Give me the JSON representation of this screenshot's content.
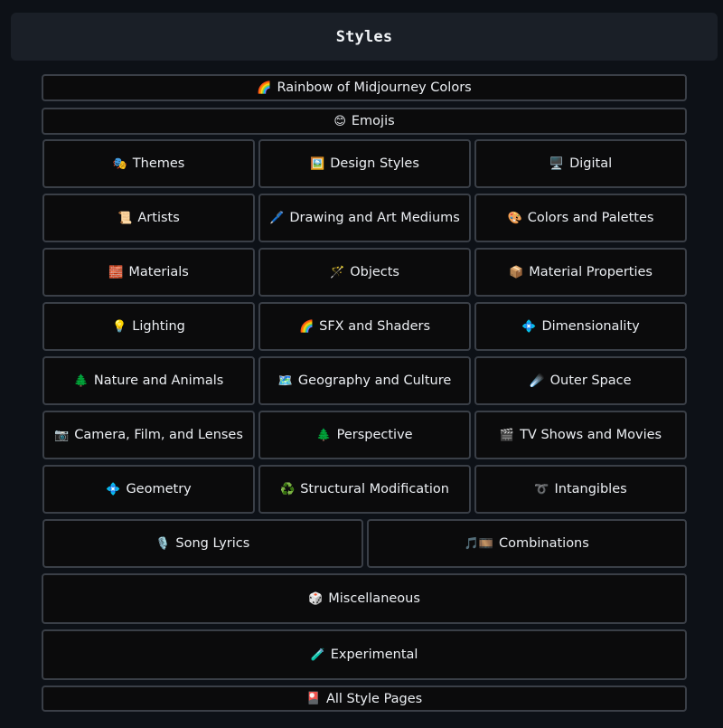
{
  "header": {
    "title": "Styles"
  },
  "rows": {
    "r0": [
      {
        "icon": "🌈",
        "label": "Rainbow of Midjourney Colors"
      }
    ],
    "r1": [
      {
        "icon": "😊",
        "label": "Emojis"
      }
    ],
    "r2": [
      {
        "icon": "🎭",
        "label": "Themes"
      },
      {
        "icon": "🖼️",
        "label": "Design Styles"
      },
      {
        "icon": "🖥️",
        "label": "Digital"
      }
    ],
    "r3": [
      {
        "icon": "📜",
        "label": "Artists"
      },
      {
        "icon": "🖊️",
        "label": "Drawing and Art Mediums"
      },
      {
        "icon": "🎨",
        "label": "Colors and Palettes"
      }
    ],
    "r4": [
      {
        "icon": "🧱",
        "label": "Materials"
      },
      {
        "icon": "🪄",
        "label": "Objects"
      },
      {
        "icon": "📦",
        "label": "Material Properties"
      }
    ],
    "r5": [
      {
        "icon": "💡",
        "label": "Lighting"
      },
      {
        "icon": "🌈",
        "label": "SFX and Shaders"
      },
      {
        "icon": "💠",
        "label": "Dimensionality"
      }
    ],
    "r6": [
      {
        "icon": "🌲",
        "label": "Nature and Animals"
      },
      {
        "icon": "🗺️",
        "label": "Geography and Culture"
      },
      {
        "icon": "☄️",
        "label": "Outer Space"
      }
    ],
    "r7": [
      {
        "icon": "📷",
        "label": "Camera, Film, and Lenses"
      },
      {
        "icon": "🌲",
        "label": "Perspective"
      },
      {
        "icon": "🎬",
        "label": "TV Shows and Movies"
      }
    ],
    "r8": [
      {
        "icon": "💠",
        "label": "Geometry"
      },
      {
        "icon": "♻️",
        "label": "Structural Modification"
      },
      {
        "icon": "➰",
        "label": "Intangibles"
      }
    ],
    "r9": [
      {
        "icon": "🎙️",
        "label": "Song Lyrics"
      },
      {
        "icon": "🎵🎞️",
        "label": "Combinations"
      }
    ],
    "r10": [
      {
        "icon": "🎲",
        "label": "Miscellaneous"
      }
    ],
    "r11": [
      {
        "icon": "🧪",
        "label": "Experimental"
      }
    ],
    "r12": [
      {
        "icon": "🎴",
        "label": "All Style Pages"
      }
    ]
  }
}
